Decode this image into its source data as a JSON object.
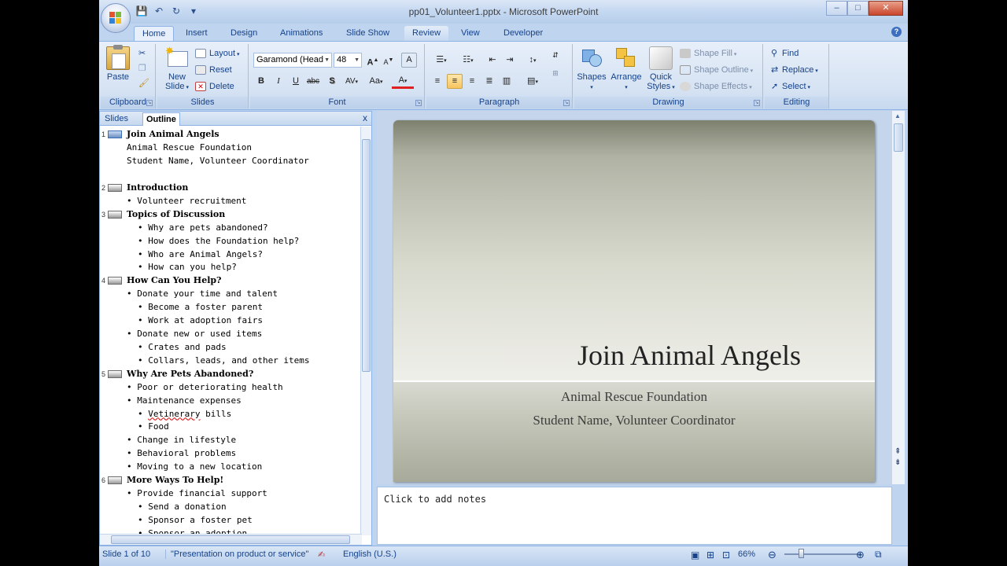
{
  "window": {
    "title": "pp01_Volunteer1.pptx - Microsoft PowerPoint",
    "controls": {
      "minimize": "–",
      "maximize": "□",
      "close": "✕"
    }
  },
  "qat": {
    "save_icon": "💾",
    "undo_icon": "↶",
    "redo_icon": "↻",
    "more_icon": "▾"
  },
  "tabs": [
    "Home",
    "Insert",
    "Design",
    "Animations",
    "Slide Show",
    "Review",
    "View",
    "Developer"
  ],
  "active_tab": "Home",
  "ribbon": {
    "clipboard": {
      "label": "Clipboard",
      "paste": "Paste"
    },
    "slides": {
      "label": "Slides",
      "new_slide": "New",
      "new_slide_2": "Slide",
      "layout": "Layout",
      "reset": "Reset",
      "delete": "Delete"
    },
    "font": {
      "label": "Font",
      "font_name": "Garamond (Head",
      "font_size": "48",
      "bold": "B",
      "italic": "I",
      "underline": "U",
      "strike": "abc",
      "shadow": "S",
      "spacing": "AV",
      "case": "Aa",
      "color": "A",
      "grow": "A",
      "shrink": "A",
      "clear": "A"
    },
    "paragraph": {
      "label": "Paragraph"
    },
    "drawing": {
      "label": "Drawing",
      "shapes": "Shapes",
      "arrange": "Arrange",
      "quick_styles": "Quick",
      "quick_styles_2": "Styles",
      "shape_fill": "Shape Fill",
      "shape_outline": "Shape Outline",
      "shape_effects": "Shape Effects"
    },
    "editing": {
      "label": "Editing",
      "find": "Find",
      "replace": "Replace",
      "select": "Select"
    }
  },
  "left_pane": {
    "tab_slides": "Slides",
    "tab_outline": "Outline",
    "close": "x",
    "outline": [
      {
        "num": "1",
        "text": "Join Animal Angels",
        "kind": "title"
      },
      {
        "text": "Animal Rescue Foundation",
        "kind": "plain"
      },
      {
        "text": "Student Name, Volunteer Coordinator",
        "kind": "plain"
      },
      {
        "num": "2",
        "text": "Introduction",
        "kind": "title"
      },
      {
        "text": "• Volunteer recruitment",
        "kind": "b1"
      },
      {
        "num": "3",
        "text": "Topics of Discussion",
        "kind": "title"
      },
      {
        "text": "• Why are pets abandoned?",
        "kind": "b2"
      },
      {
        "text": "• How does the Foundation help?",
        "kind": "b2"
      },
      {
        "text": "• Who are Animal Angels?",
        "kind": "b2"
      },
      {
        "text": "• How can you help?",
        "kind": "b2"
      },
      {
        "num": "4",
        "text": "How Can You Help?",
        "kind": "title"
      },
      {
        "text": "• Donate your time and talent",
        "kind": "b1"
      },
      {
        "text": "• Become a foster parent",
        "kind": "b2"
      },
      {
        "text": "• Work at adoption fairs",
        "kind": "b2"
      },
      {
        "text": "• Donate new or used items",
        "kind": "b1"
      },
      {
        "text": "• Crates and pads",
        "kind": "b2"
      },
      {
        "text": "• Collars, leads, and other items",
        "kind": "b2"
      },
      {
        "num": "5",
        "text": "Why Are Pets Abandoned?",
        "kind": "title"
      },
      {
        "text": "• Poor or deteriorating health",
        "kind": "b1"
      },
      {
        "text": "• Maintenance expenses",
        "kind": "b1"
      },
      {
        "text": "• Vetinerary bills",
        "kind": "b2"
      },
      {
        "text": "• Food",
        "kind": "b2"
      },
      {
        "text": "• Change in lifestyle",
        "kind": "b1"
      },
      {
        "text": "• Behavioral problems",
        "kind": "b1"
      },
      {
        "text": "• Moving to a new location",
        "kind": "b1"
      },
      {
        "num": "6",
        "text": "More Ways To Help!",
        "kind": "title"
      },
      {
        "text": "• Provide financial support",
        "kind": "b1"
      },
      {
        "text": "• Send a donation",
        "kind": "b2"
      },
      {
        "text": "• Sponsor a foster pet",
        "kind": "b2"
      },
      {
        "text": "• Sponsor an adoption",
        "kind": "b2"
      }
    ]
  },
  "slide": {
    "title": "Join Animal Angels",
    "subtitle_1": "Animal Rescue Foundation",
    "subtitle_2": "Student Name, Volunteer Coordinator"
  },
  "notes_placeholder": "Click to add notes",
  "status": {
    "slide_info": "Slide 1 of 10",
    "theme": "\"Presentation on product or service\"",
    "language": "English (U.S.)",
    "zoom": "66%",
    "zoom_level_pct": 66
  }
}
